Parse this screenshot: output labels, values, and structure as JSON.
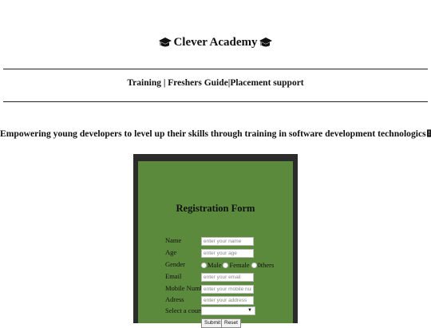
{
  "header": {
    "title": "Clever Academy",
    "icon_left": "graduation-cap-icon",
    "icon_right": "graduation-cap-icon"
  },
  "nav": {
    "training": "Training",
    "sep1": " | ",
    "freshers": "Freshers Guide",
    "sep2": "|",
    "placement": "Placement support"
  },
  "tagline": "Empowering young developers to level up their skills through training in software development technologics",
  "form": {
    "title": "Registration Form",
    "fields": {
      "name": {
        "label": "Name",
        "placeholder": "enter your name",
        "value": ""
      },
      "age": {
        "label": "Age",
        "placeholder": "enter your age",
        "value": ""
      },
      "gender": {
        "label": "Gender",
        "options": [
          "Male",
          "Female",
          "0thers"
        ]
      },
      "email": {
        "label": "Email",
        "placeholder": "enter your email",
        "value": ""
      },
      "mobile": {
        "label": "Mobile Number",
        "placeholder": "enter your mobile numl",
        "value": ""
      },
      "address": {
        "label": "Adress",
        "placeholder": "enter your address",
        "value": ""
      },
      "course": {
        "label": "Select a course",
        "selected": ""
      }
    },
    "submit_label": "Submit",
    "reset_label": "Reset"
  },
  "colors": {
    "form_bg": "#5b8a3d",
    "frame_bg": "#2b2b2b",
    "page_bg": "#ffffff"
  }
}
